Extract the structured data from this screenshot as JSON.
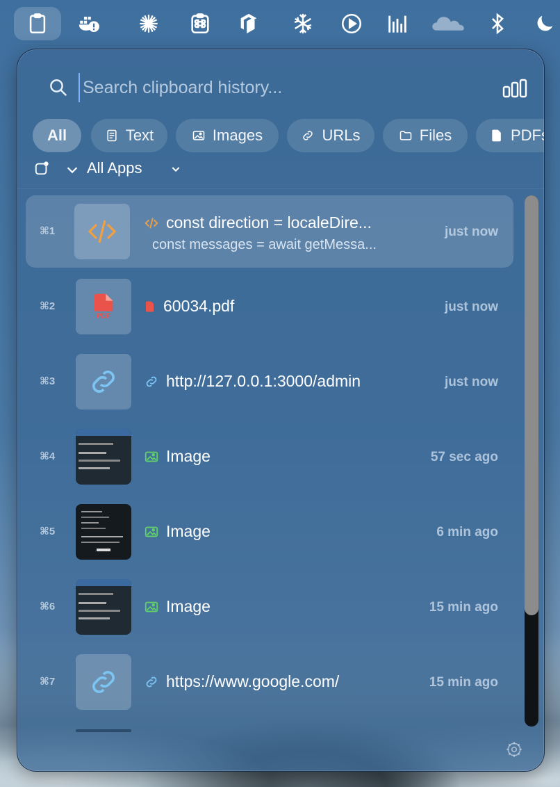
{
  "search": {
    "placeholder": "Search clipboard history..."
  },
  "filters": [
    {
      "label": "All",
      "icon": "none",
      "active": true
    },
    {
      "label": "Text",
      "icon": "text-icon"
    },
    {
      "label": "Images",
      "icon": "image-icon"
    },
    {
      "label": "URLs",
      "icon": "link-icon"
    },
    {
      "label": "Files",
      "icon": "folder-icon"
    },
    {
      "label": "PDFs",
      "icon": "pdf-icon"
    }
  ],
  "apps_filter": {
    "label": "All Apps"
  },
  "items": [
    {
      "shortcut": "⌘1",
      "kind": "code",
      "title": "const direction = localeDire...",
      "subtitle": "const messages = await getMessa...",
      "time": "just now"
    },
    {
      "shortcut": "⌘2",
      "kind": "pdf",
      "title": "60034.pdf",
      "time": "just now",
      "thumb_label": "PDF"
    },
    {
      "shortcut": "⌘3",
      "kind": "url",
      "title": "http://127.0.0.1:3000/admin",
      "time": "just now"
    },
    {
      "shortcut": "⌘4",
      "kind": "image",
      "title": "Image",
      "time": "57 sec ago"
    },
    {
      "shortcut": "⌘5",
      "kind": "image",
      "title": "Image",
      "time": "6 min ago"
    },
    {
      "shortcut": "⌘6",
      "kind": "image",
      "title": "Image",
      "time": "15 min ago"
    },
    {
      "shortcut": "⌘7",
      "kind": "url",
      "title": "https://www.google.com/",
      "time": "15 min ago"
    }
  ],
  "colors": {
    "code": "#f0a040",
    "pdf": "#e9534a",
    "url": "#7cc4f2",
    "image": "#5fd06a"
  }
}
